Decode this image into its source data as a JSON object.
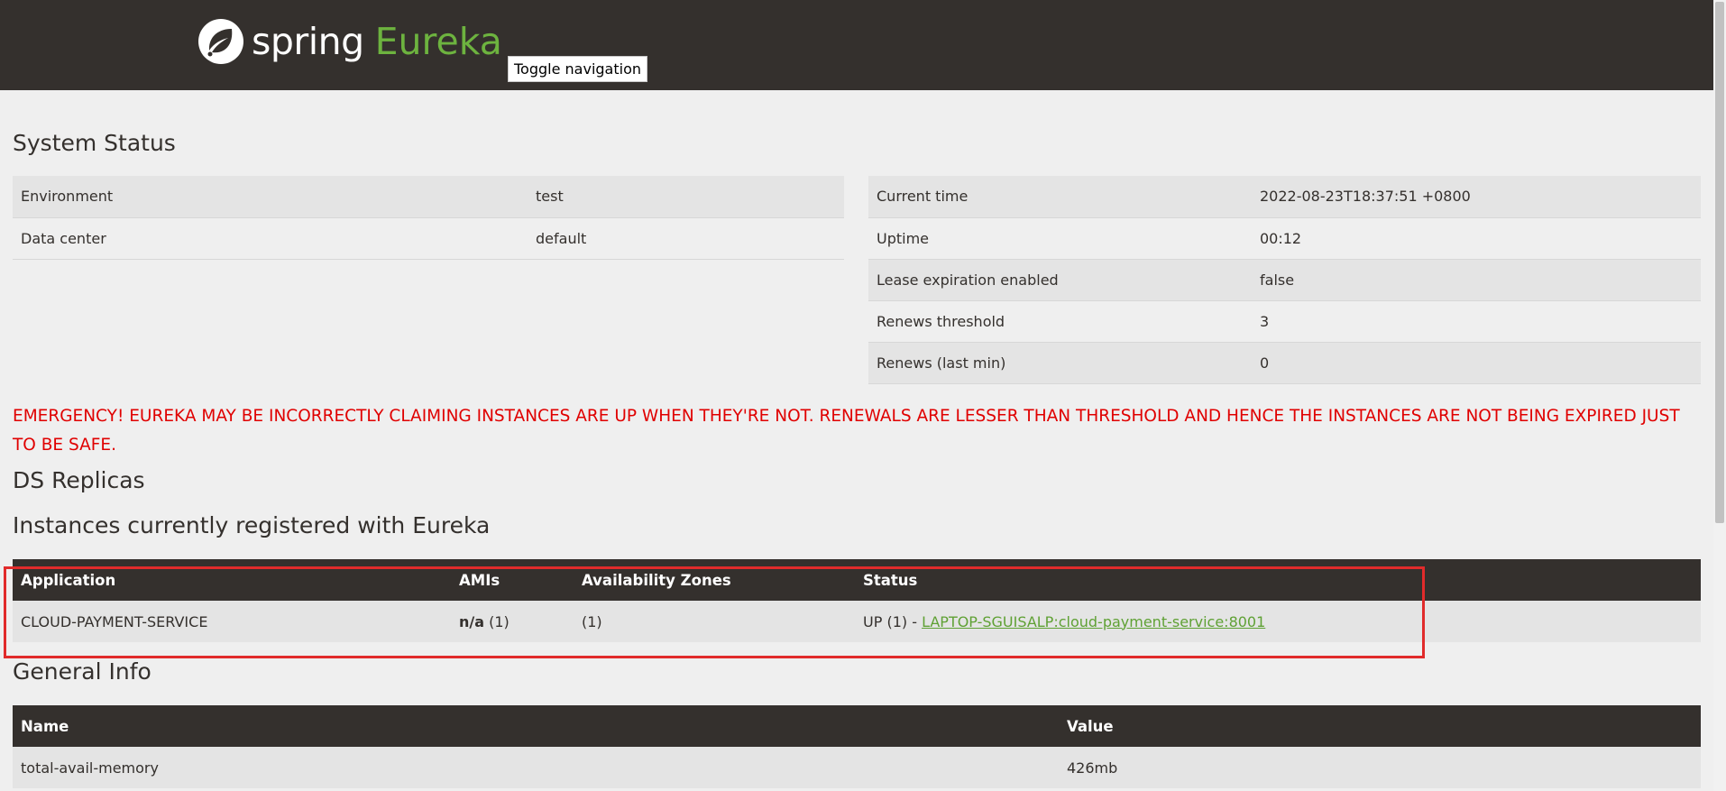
{
  "navbar": {
    "logo_word": "spring",
    "logo_product": "Eureka",
    "toggle_label": "Toggle navigation"
  },
  "system_status": {
    "title": "System Status",
    "left_rows": [
      {
        "name": "Environment",
        "value": "test"
      },
      {
        "name": "Data center",
        "value": "default"
      }
    ],
    "right_rows": [
      {
        "name": "Current time",
        "value": "2022-08-23T18:37:51 +0800"
      },
      {
        "name": "Uptime",
        "value": "00:12"
      },
      {
        "name": "Lease expiration enabled",
        "value": "false"
      },
      {
        "name": "Renews threshold",
        "value": "3"
      },
      {
        "name": "Renews (last min)",
        "value": "0"
      }
    ]
  },
  "emergency_message": "EMERGENCY! EUREKA MAY BE INCORRECTLY CLAIMING INSTANCES ARE UP WHEN THEY'RE NOT. RENEWALS ARE LESSER THAN THRESHOLD AND HENCE THE INSTANCES ARE NOT BEING EXPIRED JUST TO BE SAFE.",
  "ds_replicas": {
    "title": "DS Replicas"
  },
  "instances": {
    "title": "Instances currently registered with Eureka",
    "headers": [
      "Application",
      "AMIs",
      "Availability Zones",
      "Status"
    ],
    "rows": [
      {
        "application": "CLOUD-PAYMENT-SERVICE",
        "amis_value": "n/a",
        "amis_count": "(1)",
        "zones": "(1)",
        "status_prefix": "UP (1) -",
        "status_link": "LAPTOP-SGUISALP:cloud-payment-service:8001"
      }
    ]
  },
  "general_info": {
    "title": "General Info",
    "headers": [
      "Name",
      "Value"
    ],
    "rows": [
      {
        "name": "total-avail-memory",
        "value": "426mb"
      }
    ]
  },
  "colors": {
    "navbar_bg": "#34302d",
    "brand_green": "#6db33f",
    "emergency_red": "#e00000",
    "highlight_red": "#e12b2b"
  }
}
